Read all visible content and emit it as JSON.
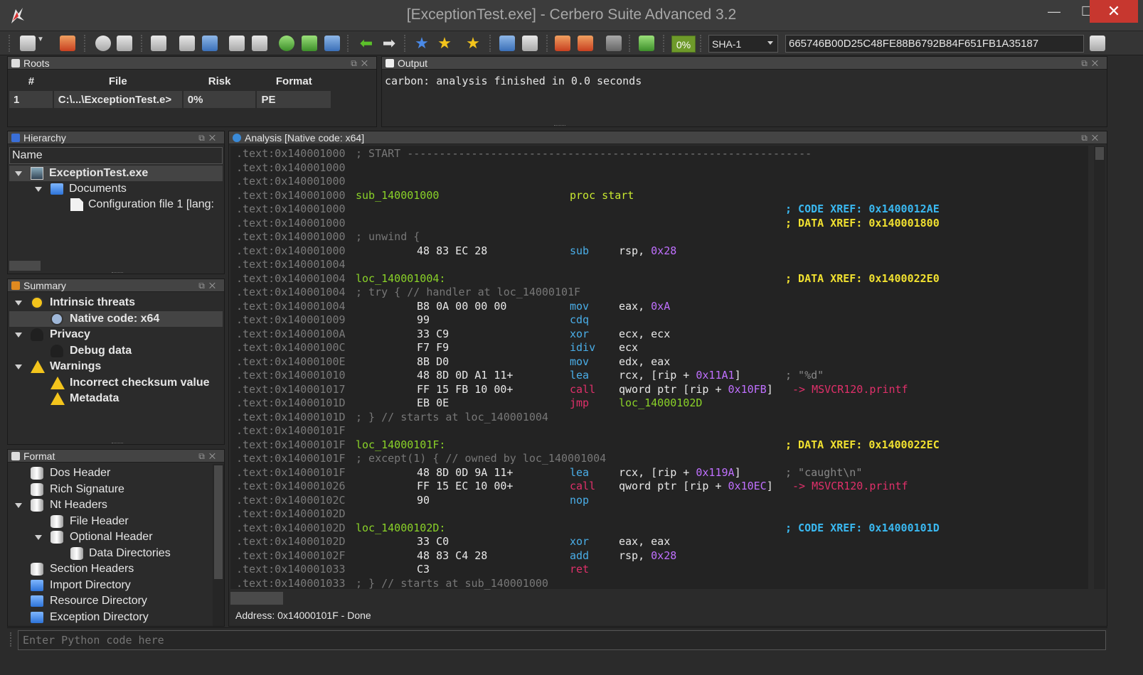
{
  "window": {
    "title": "[ExceptionTest.exe] - Cerbero Suite Advanced 3.2",
    "minimize": "—",
    "maximize": "☐",
    "close": "✕"
  },
  "toolbar": {
    "percent": "0%",
    "hash_algorithm": "SHA-1",
    "hash_value": "665746B00D25C48FE88B6792B84F651FB1A35187"
  },
  "roots": {
    "title": "Roots",
    "columns": [
      "#",
      "File",
      "Risk",
      "Format"
    ],
    "rows": [
      [
        "1",
        "C:\\...\\ExceptionTest.e>",
        "0%",
        "PE"
      ]
    ]
  },
  "output": {
    "title": "Output",
    "text": "carbon: analysis finished in 0.0 seconds"
  },
  "hierarchy": {
    "title": "Hierarchy",
    "column": "Name",
    "items": [
      "ExceptionTest.exe",
      "Documents",
      "Configuration file 1 [lang:"
    ]
  },
  "summary": {
    "title": "Summary",
    "items": [
      "Intrinsic threats",
      "Native code: x64",
      "Privacy",
      "Debug data",
      "Warnings",
      "Incorrect checksum value",
      "Metadata"
    ]
  },
  "format": {
    "title": "Format",
    "items": [
      "Dos Header",
      "Rich Signature",
      "Nt Headers",
      "File Header",
      "Optional Header",
      "Data Directories",
      "Section Headers",
      "Import Directory",
      "Resource Directory",
      "Exception Directory"
    ]
  },
  "analysis": {
    "title": "Analysis [Native code: x64]",
    "lines": [
      [
        ".text:0x140001000",
        "; START ---------------------------------------------------------------",
        "",
        "",
        "",
        "",
        ""
      ],
      [
        ".text:0x140001000",
        "",
        "",
        "",
        "",
        "",
        ""
      ],
      [
        ".text:0x140001000",
        "",
        "",
        "",
        "",
        "",
        ""
      ],
      [
        ".text:0x140001000",
        "sub_140001000",
        "",
        "proc start",
        "",
        "",
        ""
      ],
      [
        ".text:0x140001000",
        "",
        "",
        "",
        "",
        "; CODE XREF:",
        "0x1400012AE"
      ],
      [
        ".text:0x140001000",
        "",
        "",
        "",
        "",
        "; DATA XREF:",
        "0x140001800"
      ],
      [
        ".text:0x140001000",
        "; unwind {",
        "",
        "",
        "",
        "",
        ""
      ],
      [
        ".text:0x140001000",
        "",
        "48 83 EC 28",
        "sub",
        "rsp, |0x28",
        "",
        ""
      ],
      [
        ".text:0x140001004",
        "",
        "",
        "",
        "",
        "",
        ""
      ],
      [
        ".text:0x140001004",
        "loc_140001004:",
        "",
        "",
        "",
        "; DATA XREF:",
        "0x1400022E0"
      ],
      [
        ".text:0x140001004",
        "; try { // handler at loc_14000101F",
        "",
        "",
        "",
        "",
        ""
      ],
      [
        ".text:0x140001004",
        "",
        "B8 0A 00 00 00",
        "mov",
        "eax, |0xA",
        "",
        ""
      ],
      [
        ".text:0x140001009",
        "",
        "99",
        "cdq",
        "",
        "",
        ""
      ],
      [
        ".text:0x14000100A",
        "",
        "33 C9",
        "xor",
        "ecx, ecx",
        "",
        ""
      ],
      [
        ".text:0x14000100C",
        "",
        "F7 F9",
        "idiv",
        "ecx",
        "",
        ""
      ],
      [
        ".text:0x14000100E",
        "",
        "8B D0",
        "mov",
        "edx, eax",
        "",
        ""
      ],
      [
        ".text:0x140001010",
        "",
        "48 8D 0D A1 11+",
        "lea",
        "rcx, [rip + |0x11A1|]",
        "; \"%d\"",
        ""
      ],
      [
        ".text:0x140001017",
        "",
        "FF 15 FB 10 00+",
        "call",
        "qword ptr [rip + |0x10FB|]",
        "-> MSVCR120.printf",
        ""
      ],
      [
        ".text:0x14000101D",
        "",
        "EB 0E",
        "jmp",
        "loc_14000102D",
        "",
        ""
      ],
      [
        ".text:0x14000101D",
        "; } // starts at loc_140001004",
        "",
        "",
        "",
        "",
        ""
      ],
      [
        ".text:0x14000101F",
        "",
        "",
        "",
        "",
        "",
        ""
      ],
      [
        ".text:0x14000101F",
        "loc_14000101F:",
        "",
        "",
        "",
        "; DATA XREF:",
        "0x1400022EC"
      ],
      [
        ".text:0x14000101F",
        "; except(1) { // owned by loc_140001004",
        "",
        "",
        "",
        "",
        ""
      ],
      [
        ".text:0x14000101F",
        "",
        "48 8D 0D 9A 11+",
        "lea",
        "rcx, [rip + |0x119A|]",
        "; \"caught\\n\"",
        ""
      ],
      [
        ".text:0x140001026",
        "",
        "FF 15 EC 10 00+",
        "call",
        "qword ptr [rip + |0x10EC|]",
        "-> MSVCR120.printf",
        ""
      ],
      [
        ".text:0x14000102C",
        "",
        "90",
        "nop",
        "",
        "",
        ""
      ],
      [
        ".text:0x14000102D",
        "",
        "",
        "",
        "",
        "",
        ""
      ],
      [
        ".text:0x14000102D",
        "loc_14000102D:",
        "",
        "",
        "",
        "; CODE XREF:",
        "0x14000101D"
      ],
      [
        ".text:0x14000102D",
        "",
        "33 C0",
        "xor",
        "eax, eax",
        "",
        ""
      ],
      [
        ".text:0x14000102F",
        "",
        "48 83 C4 28",
        "add",
        "rsp, |0x28",
        "",
        ""
      ],
      [
        ".text:0x140001033",
        "",
        "C3",
        "ret",
        "",
        "",
        ""
      ],
      [
        ".text:0x140001033",
        "; } // starts at sub_140001000",
        "",
        "",
        "",
        "",
        ""
      ]
    ]
  },
  "status": "Address: 0x14000101F - Done",
  "python": {
    "placeholder": "Enter Python code here"
  },
  "colors": {
    "accent_close": "#c7372f",
    "label": "#8ad228",
    "mnemonic": "#4aaee8",
    "branch": "#e0306a",
    "number": "#c070ff",
    "xref_code": "#3ab8f0",
    "xref_data": "#f0e030"
  }
}
